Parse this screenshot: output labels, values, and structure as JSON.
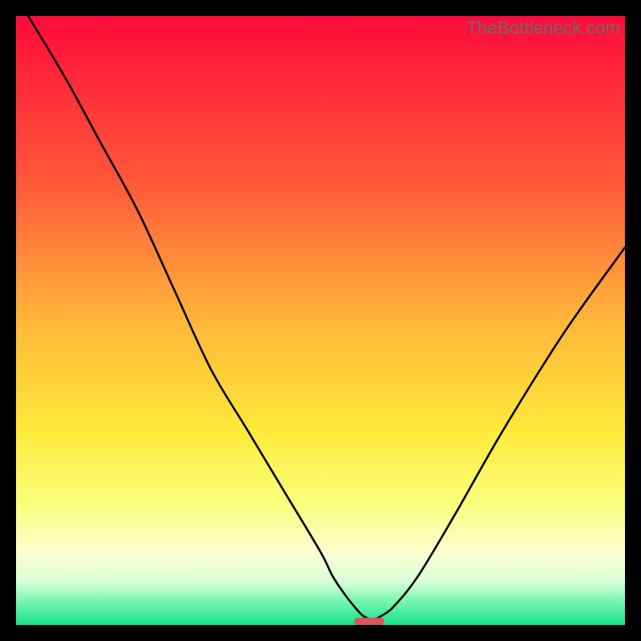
{
  "watermark": "TheBottleneck.com",
  "chart_data": {
    "type": "line",
    "title": "",
    "xlabel": "",
    "ylabel": "",
    "xlim": [
      0,
      100
    ],
    "ylim": [
      0,
      100
    ],
    "series": [
      {
        "name": "bottleneck-curve",
        "x": [
          2,
          8,
          14,
          20,
          26,
          32,
          38,
          44,
          50,
          52,
          54,
          56,
          57,
          58,
          59,
          60,
          62,
          66,
          72,
          80,
          90,
          100
        ],
        "y": [
          100,
          90,
          79,
          68,
          55,
          42,
          32,
          22,
          12,
          8,
          5,
          2.5,
          1.5,
          1,
          1,
          1.5,
          3,
          8,
          18,
          32,
          48,
          62
        ]
      }
    ],
    "marker": {
      "name": "optimal-marker",
      "x": 58,
      "y": 0.6,
      "width_pct": 5,
      "height_pct": 1.2,
      "color": "#d9565d"
    },
    "gradient_stops": [
      {
        "offset": 0,
        "color": "#ff0a3a"
      },
      {
        "offset": 28,
        "color": "#ff5a3a"
      },
      {
        "offset": 50,
        "color": "#ffb63a"
      },
      {
        "offset": 68,
        "color": "#ffe93a"
      },
      {
        "offset": 80,
        "color": "#faff7a"
      },
      {
        "offset": 88,
        "color": "#fdffd0"
      },
      {
        "offset": 93,
        "color": "#d8ffd8"
      },
      {
        "offset": 96,
        "color": "#7af5b0"
      },
      {
        "offset": 100,
        "color": "#17e38a"
      }
    ]
  }
}
